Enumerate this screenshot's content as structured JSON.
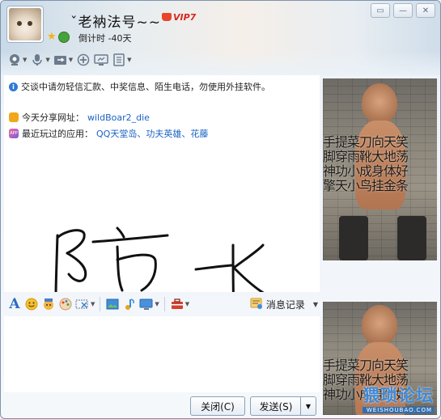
{
  "window": {
    "title": "ˇ老衲法号~~",
    "vip_label": "VIP7",
    "countdown": "倒计时 -40天",
    "controls": [
      "▭",
      "—",
      "✕"
    ]
  },
  "chat": {
    "notice": "交谈中请勿轻信汇款、中奖信息、陌生电话，勿使用外挂软件。",
    "share_label": "今天分享网址：",
    "share_link": "wildBoar2_die",
    "apps_label": "最近玩过的应用：",
    "apps_links": "QQ天堂岛、功夫英雄、花藤",
    "drawn_text": "防 水"
  },
  "toolbar_bottom": {
    "history_label": "消息记录"
  },
  "buttons": {
    "close": "关闭(C)",
    "send": "发送(S)"
  },
  "photo_caption": {
    "line1": "手提菜刀向天笑",
    "line2": "脚穿雨靴大地荡",
    "line3": "神功小成身体好",
    "line4": "擎天小鸟挂金条"
  },
  "watermark": {
    "main": "猥琐论坛",
    "sub": "WEISHOUBAO.COM"
  }
}
